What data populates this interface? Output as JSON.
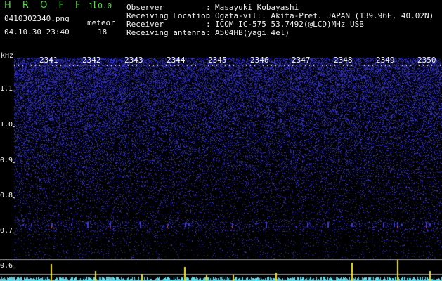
{
  "app": {
    "title": "H R O F F T",
    "version": "1.0.0"
  },
  "file": {
    "name": "0410302340.png",
    "datetime": "04.10.30 23:40"
  },
  "meteor": {
    "label": "meteor",
    "count": "18"
  },
  "info": [
    {
      "key": "Observer",
      "value": "Masayuki Kobayashi"
    },
    {
      "key": "Receiving Location",
      "value": "Ogata-vill. Akita-Pref. JAPAN (139.96E, 40.02N)"
    },
    {
      "key": "Receiver",
      "value": "ICOM IC-575 53.7492(@LCD)MHz USB"
    },
    {
      "key": "Receiving antenna",
      "value": "A504HB(yagi 4el)"
    }
  ],
  "spectrogram": {
    "unit": "kHz",
    "time_ticks": [
      "2341",
      "2342",
      "2343",
      "2344",
      "2345",
      "2346",
      "2347",
      "2348",
      "2349",
      "2350"
    ],
    "freq_ticks": [
      "1.1",
      "1.0",
      "0.9",
      "0.8",
      "0.7",
      "0.6"
    ],
    "colors": {
      "background": "#000000",
      "noise": "#3c3cd8",
      "echo": "#ff3030",
      "spectrum": "#5fe0f0",
      "peak": "#f0e020",
      "axis": "#c8c8c8"
    }
  }
}
